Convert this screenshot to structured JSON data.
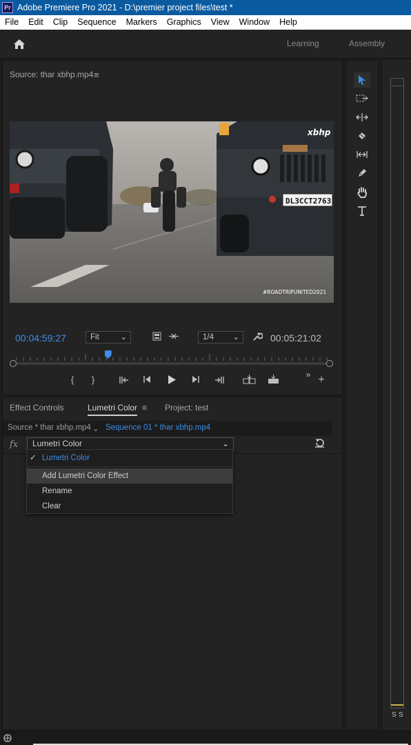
{
  "titlebar": {
    "app_icon": "Pr",
    "title": "Adobe Premiere Pro 2021 - D:\\premier project files\\test *"
  },
  "menubar": {
    "items": [
      "File",
      "Edit",
      "Clip",
      "Sequence",
      "Markers",
      "Graphics",
      "View",
      "Window",
      "Help"
    ]
  },
  "header": {
    "workspaces": [
      "Learning",
      "Assembly"
    ]
  },
  "source_monitor": {
    "title": "Source: thar xbhp.mp4",
    "video_overlay_logo": "xbhp",
    "video_overlay_tag": "#ROADTRIPUNITED2021",
    "video_plate_text": "DL3CCT2763",
    "timecode_in": "00:04:59:27",
    "zoom": "Fit",
    "resolution": "1/4",
    "timecode_out": "00:05:21:02",
    "playhead_position": 0.3
  },
  "effect_controls": {
    "tabs": [
      "Effect Controls",
      "Lumetri Color",
      "Project: test"
    ],
    "active_tab": "Lumetri Color",
    "source_crumb": "Source * thar xbhp.mp4",
    "sequence_crumb": "Sequence 01 * thar xbhp.mp4",
    "fx_label": "fx",
    "selected_effect": "Lumetri Color",
    "menu": {
      "checked_item": "Lumetri Color",
      "items": [
        "Add Lumetri Color Effect",
        "Rename",
        "Clear"
      ]
    }
  },
  "meters": {
    "left_label": "S",
    "right_label": "S"
  },
  "colors": {
    "accent": "#3a8ee6",
    "titlebar": "#0a5aa0",
    "panel": "#232323"
  }
}
